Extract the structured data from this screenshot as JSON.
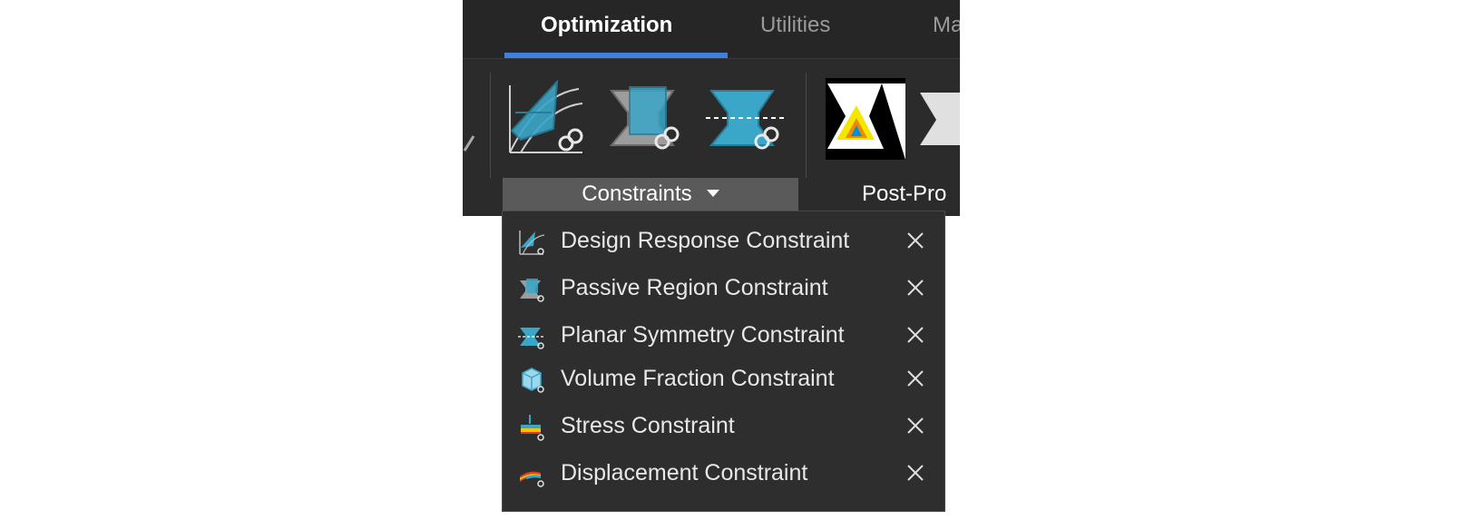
{
  "ribbon": {
    "tabs": [
      {
        "label": "Optimization",
        "active": true
      },
      {
        "label": "Utilities",
        "active": false
      },
      {
        "label": "Ma",
        "active": false
      }
    ],
    "tools": [
      {
        "icon": "design-response-constraint-icon"
      },
      {
        "icon": "passive-region-constraint-icon"
      },
      {
        "icon": "planar-symmetry-constraint-icon"
      },
      {
        "icon": "optimization-result-icon"
      }
    ],
    "groups": {
      "constraints_label": "Constraints",
      "post_label": "Post-Pro"
    }
  },
  "menu": {
    "items": [
      {
        "label": "Design Response Constraint",
        "icon": "design-response-constraint-icon"
      },
      {
        "label": "Passive Region Constraint",
        "icon": "passive-region-constraint-icon"
      },
      {
        "label": "Planar Symmetry Constraint",
        "icon": "planar-symmetry-constraint-icon"
      },
      {
        "label": "Volume Fraction Constraint",
        "icon": "volume-fraction-constraint-icon"
      },
      {
        "label": "Stress Constraint",
        "icon": "stress-constraint-icon"
      },
      {
        "label": "Displacement Constraint",
        "icon": "displacement-constraint-icon"
      }
    ],
    "remove_icon": "close-icon"
  },
  "colors": {
    "ribbon_bg": "#2b2b2b",
    "accent": "#3f7fe0",
    "menu_bg": "#2e2e2e",
    "icon_teal": "#3aa6c8",
    "text": "#e8e8e8"
  }
}
